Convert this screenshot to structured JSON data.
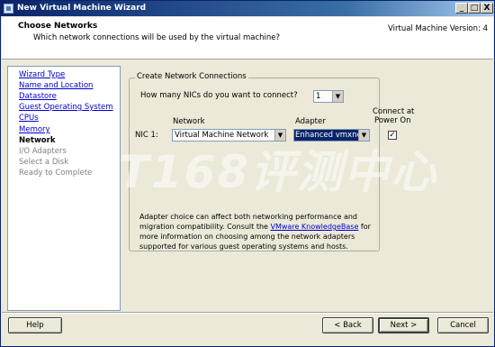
{
  "window": {
    "title": "New Virtual Machine Wizard"
  },
  "titlebar_buttons": {
    "minimize": "_",
    "maximize": "□",
    "close": "X"
  },
  "header": {
    "title": "Choose Networks",
    "subtitle": "Which network connections will be used by the virtual machine?",
    "version": "Virtual Machine Version: 4"
  },
  "sidebar": {
    "items": [
      {
        "label": "Wizard Type",
        "state": "link"
      },
      {
        "label": "Name and Location",
        "state": "link"
      },
      {
        "label": "Datastore",
        "state": "link"
      },
      {
        "label": "Guest Operating System",
        "state": "link"
      },
      {
        "label": "CPUs",
        "state": "link"
      },
      {
        "label": "Memory",
        "state": "link"
      },
      {
        "label": "Network",
        "state": "current"
      },
      {
        "label": "I/O Adapters",
        "state": "disabled"
      },
      {
        "label": "Select a Disk",
        "state": "disabled"
      },
      {
        "label": "Ready to Complete",
        "state": "disabled"
      }
    ]
  },
  "group": {
    "legend": "Create Network Connections",
    "nic_count_label": "How many NICs do you want to connect?",
    "nic_count_value": "1",
    "col_network": "Network",
    "col_adapter": "Adapter",
    "col_connect_line1": "Connect at",
    "col_connect_line2": "Power On",
    "nic_label": "NIC 1:",
    "network_value": "Virtual Machine Network",
    "adapter_value": "Enhanced vmxnet",
    "connect_checked": true,
    "note_part1": "Adapter choice can affect both networking performance and migration compatibility. Consult the ",
    "note_link": "VMware KnowledgeBase",
    "note_part2": " for more information on choosing among the network adapters supported for various guest operating systems and hosts."
  },
  "watermark": "IT168评测中心",
  "buttons": {
    "help": "Help",
    "back": "< Back",
    "next": "Next >",
    "cancel": "Cancel"
  },
  "icons": {
    "dropdown": "▼",
    "check": "✓"
  }
}
